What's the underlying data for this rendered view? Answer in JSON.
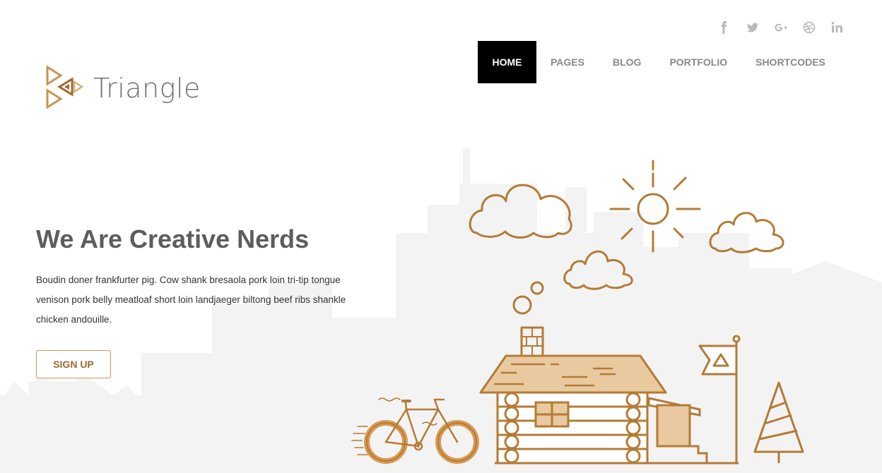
{
  "social": [
    {
      "icon": "facebook-icon",
      "glyph": "f"
    },
    {
      "icon": "twitter-icon",
      "glyph": "t"
    },
    {
      "icon": "google-plus-icon",
      "glyph": "g+"
    },
    {
      "icon": "dribbble-icon",
      "glyph": "d"
    },
    {
      "icon": "linkedin-icon",
      "glyph": "in"
    }
  ],
  "brand": {
    "name": "Triangle"
  },
  "nav": {
    "items": [
      "HOME",
      "PAGES",
      "BLOG",
      "PORTFOLIO",
      "SHORTCODES"
    ],
    "active": "HOME"
  },
  "hero": {
    "title": "We Are Creative Nerds",
    "body": "Boudin doner frankfurter pig. Cow shank bresaola pork loin tri-tip tongue venison pork belly meatloaf short loin landjaeger biltong beef ribs shankle chicken andouille.",
    "cta": "SIGN UP"
  },
  "colors": {
    "accent": "#b47b35",
    "accent_light": "#e8c9a0",
    "nav_active_bg": "#000000",
    "skyline": "#f3f3f3",
    "social": "#b9b9b9"
  }
}
